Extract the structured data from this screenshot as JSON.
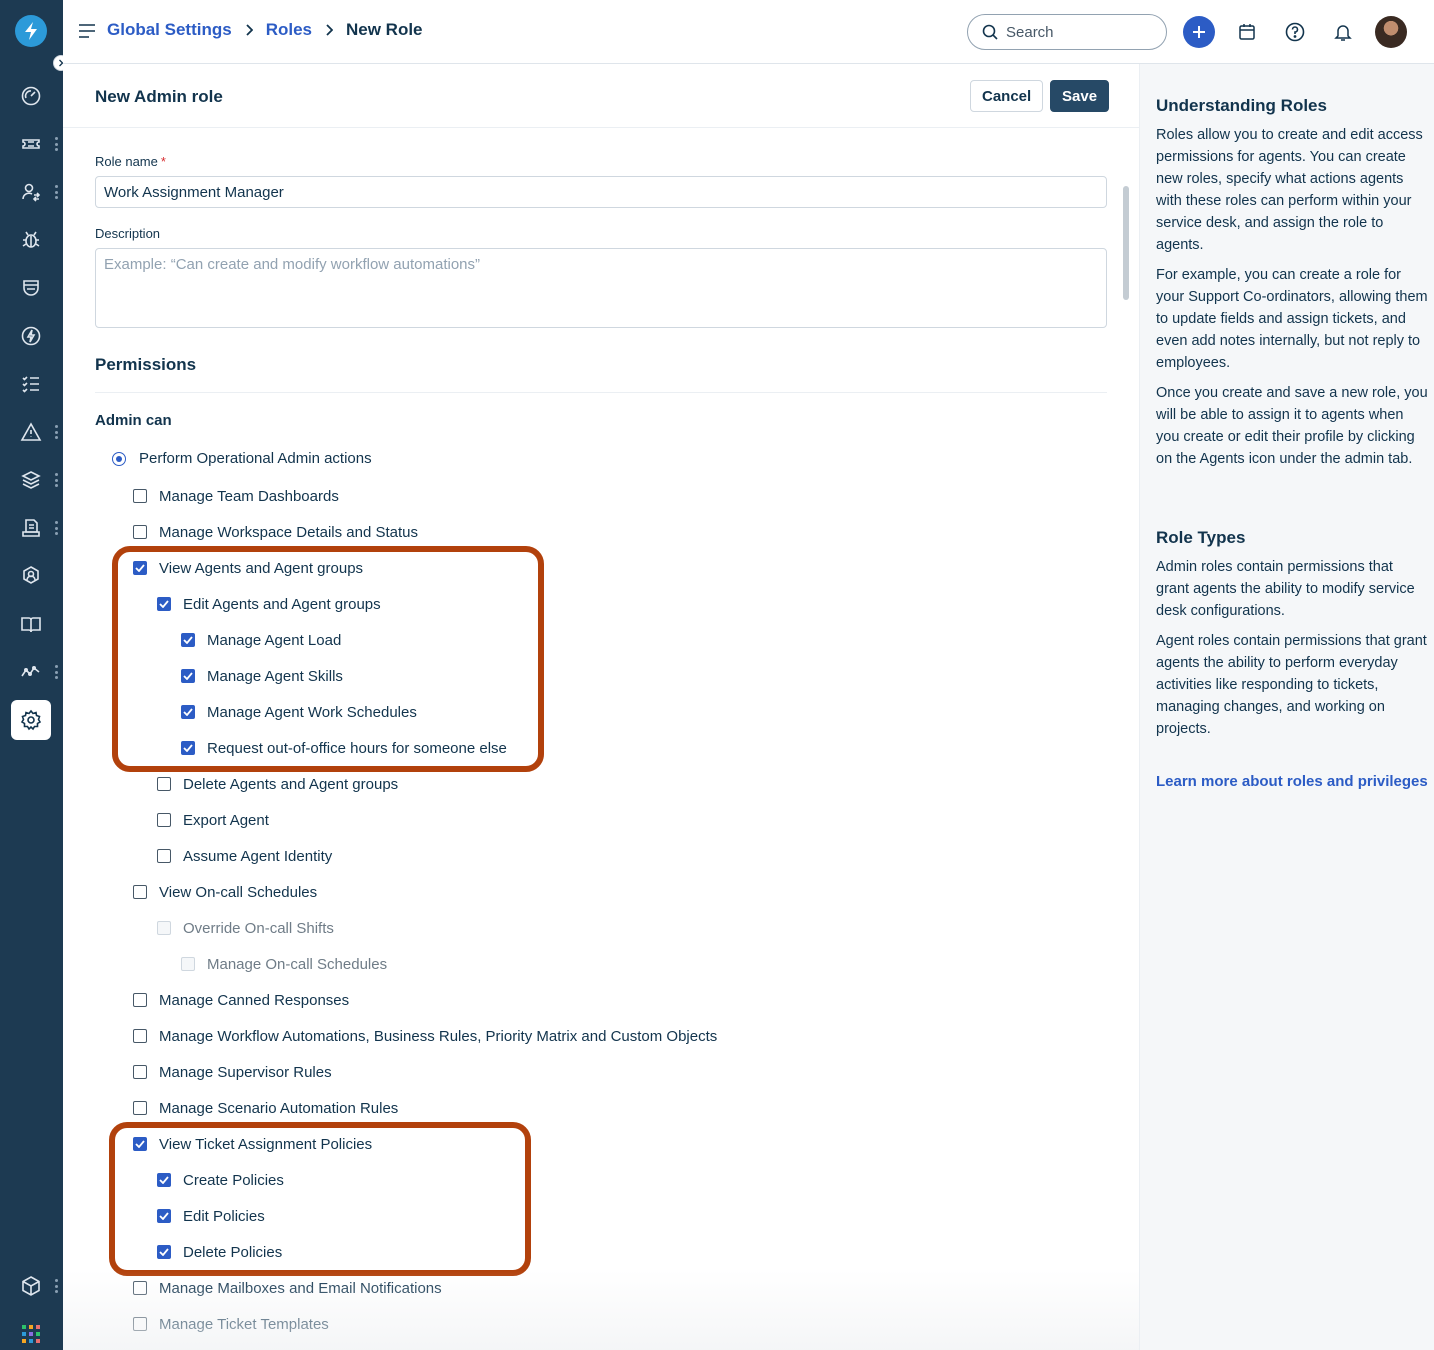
{
  "header": {
    "breadcrumb": [
      "Global Settings",
      "Roles",
      "New Role"
    ],
    "search_placeholder": "Search"
  },
  "form": {
    "title": "New Admin role",
    "cancel_label": "Cancel",
    "save_label": "Save",
    "role_name_label": "Role name",
    "required_marker": "*",
    "role_name_value": "Work Assignment Manager",
    "description_label": "Description",
    "description_placeholder": "Example: “Can create and modify workflow automations”"
  },
  "permissions": {
    "title": "Permissions",
    "admin_can_label": "Admin can",
    "option_label": "Perform Operational Admin actions",
    "items": [
      {
        "label": "Manage Team Dashboards",
        "checked": false,
        "disabled": false
      },
      {
        "label": "Manage Workspace Details and Status",
        "checked": false,
        "disabled": false
      },
      {
        "label": "View Agents and Agent groups",
        "checked": true,
        "disabled": false
      },
      {
        "label": "Edit Agents and Agent groups",
        "checked": true,
        "disabled": false
      },
      {
        "label": "Manage Agent Load",
        "checked": true,
        "disabled": false
      },
      {
        "label": "Manage Agent Skills",
        "checked": true,
        "disabled": false
      },
      {
        "label": "Manage Agent Work Schedules",
        "checked": true,
        "disabled": false
      },
      {
        "label": "Request out-of-office hours for someone else",
        "checked": true,
        "disabled": false
      },
      {
        "label": "Delete Agents and Agent groups",
        "checked": false,
        "disabled": false
      },
      {
        "label": "Export Agent",
        "checked": false,
        "disabled": false
      },
      {
        "label": "Assume Agent Identity",
        "checked": false,
        "disabled": false
      },
      {
        "label": "View On-call Schedules",
        "checked": false,
        "disabled": false
      },
      {
        "label": "Override On-call Shifts",
        "checked": false,
        "disabled": true
      },
      {
        "label": "Manage On-call Schedules",
        "checked": false,
        "disabled": true
      },
      {
        "label": "Manage Canned Responses",
        "checked": false,
        "disabled": false
      },
      {
        "label": "Manage Workflow Automations, Business Rules, Priority Matrix and Custom Objects",
        "checked": false,
        "disabled": false
      },
      {
        "label": "Manage Supervisor Rules",
        "checked": false,
        "disabled": false
      },
      {
        "label": "Manage Scenario Automation Rules",
        "checked": false,
        "disabled": false
      },
      {
        "label": "View Ticket Assignment Policies",
        "checked": true,
        "disabled": false
      },
      {
        "label": "Create Policies",
        "checked": true,
        "disabled": false
      },
      {
        "label": "Edit Policies",
        "checked": true,
        "disabled": false
      },
      {
        "label": "Delete Policies",
        "checked": true,
        "disabled": false
      },
      {
        "label": "Manage Mailboxes and Email Notifications",
        "checked": false,
        "disabled": false
      },
      {
        "label": "Manage Ticket Templates",
        "checked": false,
        "disabled": false
      }
    ]
  },
  "aside": {
    "title1": "Understanding Roles",
    "p1": "Roles allow you to create and edit access permissions for agents. You can create new roles, specify what actions agents with these roles can perform within your service desk, and assign the role to agents.",
    "p2": "For example, you can create a role for your Support Co-ordinators, allowing them to update fields and assign tickets, and even add notes internally, but not reply to employees.",
    "p3": "Once you create and save a new role, you will be able to assign it to agents when you create or edit their profile by clicking on the Agents icon under the admin tab.",
    "title2": "Role Types",
    "p4": "Admin roles contain permissions that grant agents the ability to modify service desk configurations.",
    "p5": "Agent roles contain permissions that grant agents the ability to perform everyday activities like responding to tickets, managing changes, and working on projects.",
    "link": "Learn more about roles and privileges"
  },
  "icons": {
    "rail": [
      "dashboard-icon",
      "tickets-icon",
      "changes-icon",
      "problems-icon",
      "assets-icon",
      "automation-icon",
      "tasks-icon",
      "alerts-icon",
      "projects-icon",
      "reports-icon",
      "catalog-icon",
      "solutions-icon",
      "analytics-icon",
      "admin-settings-icon",
      "marketplace-icon",
      "apps-grid-icon"
    ]
  },
  "colors": {
    "rail_bg": "#1d3a52",
    "accent": "#2c5cc5",
    "highlight": "#b2410c",
    "save_button": "#264966"
  }
}
